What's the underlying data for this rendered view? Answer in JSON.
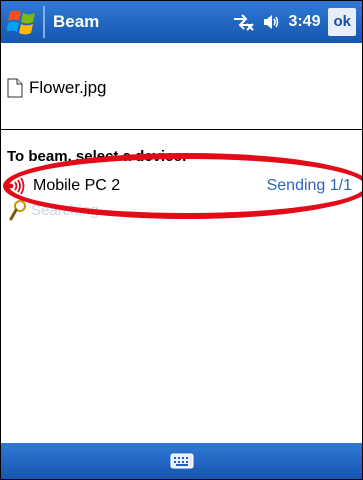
{
  "titlebar": {
    "app_title": "Beam",
    "time": "3:49",
    "ok_label": "ok",
    "start_icon": "windows-flag-icon",
    "connectivity_icon": "connectivity-icon",
    "volume_icon": "speaker-icon"
  },
  "file": {
    "name": "Flower.jpg",
    "icon": "document-icon"
  },
  "instruction": "To beam, select a device:",
  "devices": [
    {
      "name": "Mobile PC 2",
      "status": "Sending 1/1",
      "icon": "infrared-icon"
    }
  ],
  "searching": {
    "label": "Searching",
    "icon": "magnifier-icon"
  },
  "bottombar": {
    "keyboard_icon": "keyboard-icon"
  },
  "colors": {
    "titlebar": "#1f66c4",
    "status_text": "#2b66b8",
    "highlight": "#e30b17"
  }
}
